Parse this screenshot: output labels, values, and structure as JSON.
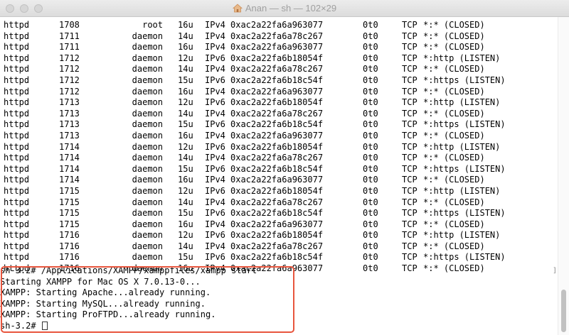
{
  "window": {
    "title": "Anan — sh — 102×29"
  },
  "processes": [
    {
      "cmd": "httpd",
      "pid": "1708",
      "user": "root",
      "fd": "16u",
      "type": "IPv4",
      "device": "0xac2a22fa6a963077",
      "size": "0t0",
      "node": "TCP",
      "name": "*:* (CLOSED)"
    },
    {
      "cmd": "httpd",
      "pid": "1711",
      "user": "daemon",
      "fd": "14u",
      "type": "IPv4",
      "device": "0xac2a22fa6a78c267",
      "size": "0t0",
      "node": "TCP",
      "name": "*:* (CLOSED)"
    },
    {
      "cmd": "httpd",
      "pid": "1711",
      "user": "daemon",
      "fd": "16u",
      "type": "IPv4",
      "device": "0xac2a22fa6a963077",
      "size": "0t0",
      "node": "TCP",
      "name": "*:* (CLOSED)"
    },
    {
      "cmd": "httpd",
      "pid": "1712",
      "user": "daemon",
      "fd": "12u",
      "type": "IPv6",
      "device": "0xac2a22fa6b18054f",
      "size": "0t0",
      "node": "TCP",
      "name": "*:http (LISTEN)"
    },
    {
      "cmd": "httpd",
      "pid": "1712",
      "user": "daemon",
      "fd": "14u",
      "type": "IPv4",
      "device": "0xac2a22fa6a78c267",
      "size": "0t0",
      "node": "TCP",
      "name": "*:* (CLOSED)"
    },
    {
      "cmd": "httpd",
      "pid": "1712",
      "user": "daemon",
      "fd": "15u",
      "type": "IPv6",
      "device": "0xac2a22fa6b18c54f",
      "size": "0t0",
      "node": "TCP",
      "name": "*:https (LISTEN)"
    },
    {
      "cmd": "httpd",
      "pid": "1712",
      "user": "daemon",
      "fd": "16u",
      "type": "IPv4",
      "device": "0xac2a22fa6a963077",
      "size": "0t0",
      "node": "TCP",
      "name": "*:* (CLOSED)"
    },
    {
      "cmd": "httpd",
      "pid": "1713",
      "user": "daemon",
      "fd": "12u",
      "type": "IPv6",
      "device": "0xac2a22fa6b18054f",
      "size": "0t0",
      "node": "TCP",
      "name": "*:http (LISTEN)"
    },
    {
      "cmd": "httpd",
      "pid": "1713",
      "user": "daemon",
      "fd": "14u",
      "type": "IPv4",
      "device": "0xac2a22fa6a78c267",
      "size": "0t0",
      "node": "TCP",
      "name": "*:* (CLOSED)"
    },
    {
      "cmd": "httpd",
      "pid": "1713",
      "user": "daemon",
      "fd": "15u",
      "type": "IPv6",
      "device": "0xac2a22fa6b18c54f",
      "size": "0t0",
      "node": "TCP",
      "name": "*:https (LISTEN)"
    },
    {
      "cmd": "httpd",
      "pid": "1713",
      "user": "daemon",
      "fd": "16u",
      "type": "IPv4",
      "device": "0xac2a22fa6a963077",
      "size": "0t0",
      "node": "TCP",
      "name": "*:* (CLOSED)"
    },
    {
      "cmd": "httpd",
      "pid": "1714",
      "user": "daemon",
      "fd": "12u",
      "type": "IPv6",
      "device": "0xac2a22fa6b18054f",
      "size": "0t0",
      "node": "TCP",
      "name": "*:http (LISTEN)"
    },
    {
      "cmd": "httpd",
      "pid": "1714",
      "user": "daemon",
      "fd": "14u",
      "type": "IPv4",
      "device": "0xac2a22fa6a78c267",
      "size": "0t0",
      "node": "TCP",
      "name": "*:* (CLOSED)"
    },
    {
      "cmd": "httpd",
      "pid": "1714",
      "user": "daemon",
      "fd": "15u",
      "type": "IPv6",
      "device": "0xac2a22fa6b18c54f",
      "size": "0t0",
      "node": "TCP",
      "name": "*:https (LISTEN)"
    },
    {
      "cmd": "httpd",
      "pid": "1714",
      "user": "daemon",
      "fd": "16u",
      "type": "IPv4",
      "device": "0xac2a22fa6a963077",
      "size": "0t0",
      "node": "TCP",
      "name": "*:* (CLOSED)"
    },
    {
      "cmd": "httpd",
      "pid": "1715",
      "user": "daemon",
      "fd": "12u",
      "type": "IPv6",
      "device": "0xac2a22fa6b18054f",
      "size": "0t0",
      "node": "TCP",
      "name": "*:http (LISTEN)"
    },
    {
      "cmd": "httpd",
      "pid": "1715",
      "user": "daemon",
      "fd": "14u",
      "type": "IPv4",
      "device": "0xac2a22fa6a78c267",
      "size": "0t0",
      "node": "TCP",
      "name": "*:* (CLOSED)"
    },
    {
      "cmd": "httpd",
      "pid": "1715",
      "user": "daemon",
      "fd": "15u",
      "type": "IPv6",
      "device": "0xac2a22fa6b18c54f",
      "size": "0t0",
      "node": "TCP",
      "name": "*:https (LISTEN)"
    },
    {
      "cmd": "httpd",
      "pid": "1715",
      "user": "daemon",
      "fd": "16u",
      "type": "IPv4",
      "device": "0xac2a22fa6a963077",
      "size": "0t0",
      "node": "TCP",
      "name": "*:* (CLOSED)"
    },
    {
      "cmd": "httpd",
      "pid": "1716",
      "user": "daemon",
      "fd": "12u",
      "type": "IPv6",
      "device": "0xac2a22fa6b18054f",
      "size": "0t0",
      "node": "TCP",
      "name": "*:http (LISTEN)"
    },
    {
      "cmd": "httpd",
      "pid": "1716",
      "user": "daemon",
      "fd": "14u",
      "type": "IPv4",
      "device": "0xac2a22fa6a78c267",
      "size": "0t0",
      "node": "TCP",
      "name": "*:* (CLOSED)"
    },
    {
      "cmd": "httpd",
      "pid": "1716",
      "user": "daemon",
      "fd": "15u",
      "type": "IPv6",
      "device": "0xac2a22fa6b18c54f",
      "size": "0t0",
      "node": "TCP",
      "name": "*:https (LISTEN)"
    },
    {
      "cmd": "httpd",
      "pid": "1716",
      "user": "daemon",
      "fd": "16u",
      "type": "IPv4",
      "device": "0xac2a22fa6a963077",
      "size": "0t0",
      "node": "TCP",
      "name": "*:* (CLOSED)"
    }
  ],
  "output": {
    "command_line": "sh-3.2# /Applications/XAMPP/xamppfiles/xampp start",
    "starting": "Starting XAMPP for Mac OS X 7.0.13-0...",
    "apache": "XAMPP: Starting Apache...already running.",
    "mysql": "XAMPP: Starting MySQL...already running.",
    "proftpd": "XAMPP: Starting ProFTPD...already running.",
    "prompt": "sh-3.2# "
  },
  "bracket": "]",
  "colors": {
    "highlight_border": "#e8553d",
    "text": "#000000"
  }
}
